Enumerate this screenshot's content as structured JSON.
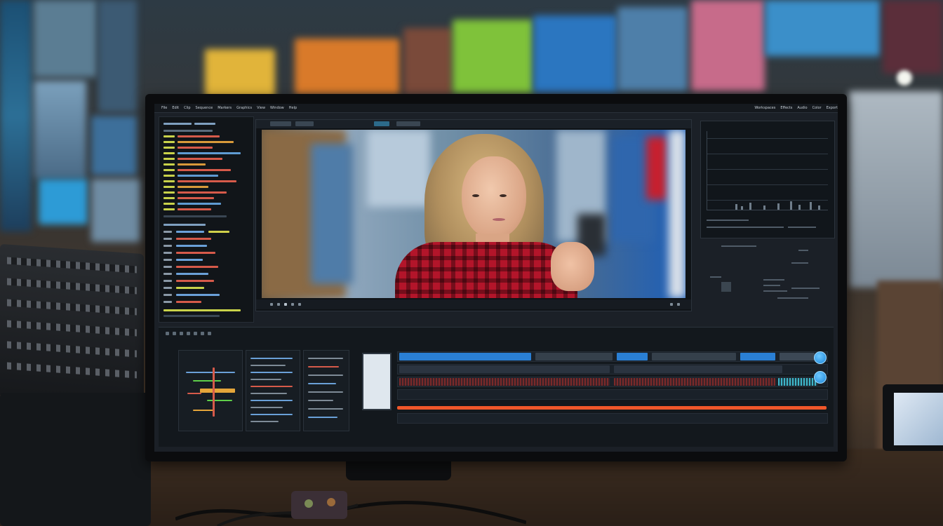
{
  "scene": {
    "description_free": true
  },
  "editor": {
    "menu_items": [
      "File",
      "Edit",
      "Clip",
      "Sequence",
      "Markers",
      "Graphics",
      "View",
      "Window",
      "Help"
    ],
    "right_menu_items": [
      "Workspaces",
      "Effects",
      "Audio",
      "Color",
      "Export"
    ],
    "timeline": {
      "playhead_color": "#f0572a",
      "accent_color": "#1d86d8"
    }
  },
  "icons": {
    "knob_upper": "circle-knob-icon",
    "knob_lower": "circle-knob-icon"
  }
}
